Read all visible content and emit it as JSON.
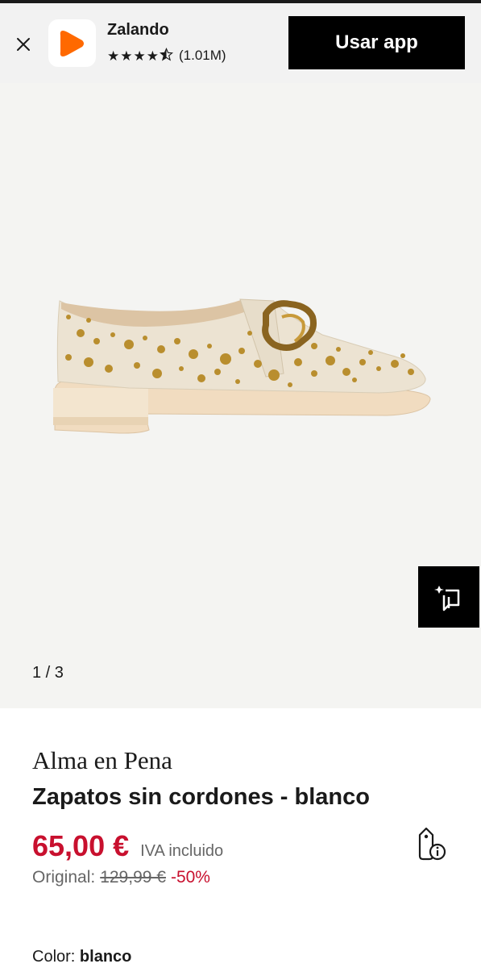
{
  "banner": {
    "app_name": "Zalando",
    "rating_stars": 4.5,
    "rating_count": "(1.01M)",
    "cta_label": "Usar app",
    "brand_color": "#ff6900"
  },
  "gallery": {
    "pager": "1 / 3",
    "similar_icon": "find-similar-icon"
  },
  "product": {
    "brand": "Alma en Pena",
    "name": "Zapatos sin cordones - blanco",
    "price": "65,00 €",
    "vat_note": "IVA incluido",
    "original_label": "Original:",
    "original_price": "129,99 €",
    "discount": "-50%",
    "color_label": "Color:",
    "color_value": "blanco",
    "price_color": "#c8102e"
  }
}
